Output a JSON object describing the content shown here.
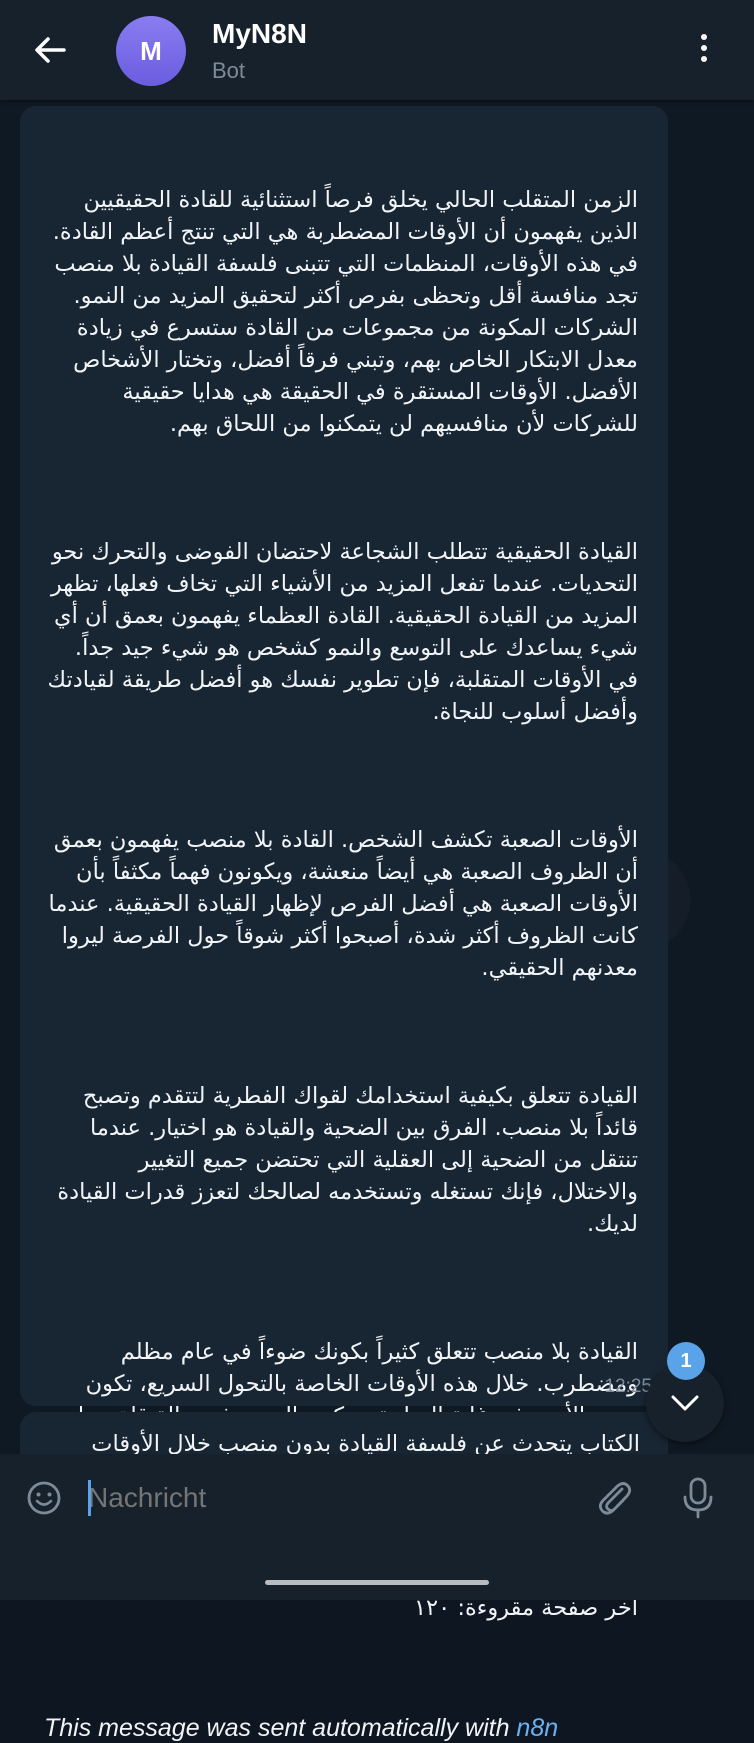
{
  "header": {
    "title": "MyN8N",
    "subtitle": "Bot",
    "avatar_letter": "M"
  },
  "message": {
    "paragraphs": [
      "الزمن المتقلب الحالي يخلق فرصاً استثنائية للقادة الحقيقيين الذين يفهمون أن الأوقات المضطربة هي التي تنتج أعظم القادة. في هذه الأوقات، المنظمات التي تتبنى فلسفة القيادة بلا منصب تجد منافسة أقل وتحظى بفرص أكثر لتحقيق المزيد من النمو. الشركات المكونة من مجموعات من القادة ستسرع في زيادة معدل الابتكار الخاص بهم، وتبني فرقاً أفضل، وتختار الأشخاص الأفضل. الأوقات المستقرة في الحقيقة هي هدايا حقيقية للشركات لأن منافسيهم لن يتمكنوا من اللحاق بهم.",
      "القيادة الحقيقية تتطلب الشجاعة لاحتضان الفوضى والتحرك نحو التحديات. عندما تفعل المزيد من الأشياء التي تخاف فعلها، تظهر المزيد من القيادة الحقيقية. القادة العظماء يفهمون بعمق أن أي شيء يساعدك على التوسع والنمو كشخص هو شيء جيد جداً. في الأوقات المتقلبة، فإن تطوير نفسك هو أفضل طريقة لقيادتك وأفضل أسلوب للنجاة.",
      "الأوقات الصعبة تكشف الشخص. القادة بلا منصب يفهمون بعمق أن الظروف الصعبة هي أيضاً منعشة، ويكونون فهماً مكثفاً بأن الأوقات الصعبة هي أفضل الفرص لإظهار القيادة الحقيقية. عندما كانت الظروف أكثر شدة، أصبحوا أكثر شوقاً حول الفرصة ليروا معدنهم الحقيقي.",
      "القيادة تتعلق بكيفية استخدامك لقواك الفطرية لتتقدم وتصبح قائداً بلا منصب. الفرق بين الضحية والقيادة هو اختيار. عندما تنتقل من الضحية إلى العقلية التي تحتضن جميع التغيير والاختلال، فإنك تستغله وتستخدمه لصالحك لتعزز قدرات القيادة لديك.",
      "القيادة بلا منصب تتعلق كثيراً بكونك ضوءاً في عام مظلم ومضطرب. خلال هذه الأوقات الخاصة بالتحول السريع، تكون جميع الأمور في غاية السلبية، ويكون الجميع في حالة قلق. ما نحتاجه الآن هو المزيد من الأشخاص الذين يكونون ضوء ثبات لامع، ممتلئين بالأمل، ويوضحون للآخرين طريقاً واضحاً."
    ],
    "last_page": "آخر صفحة مقروءة: ١٢٠",
    "footer_prefix": "This message was sent automatically with ",
    "footer_link": "n8n",
    "time": "12:25"
  },
  "next_message": {
    "text": "الكتاب يتحدث عن فلسفة القيادة بدون منصب خلال الأوقات"
  },
  "unread_count": "1",
  "composer": {
    "placeholder": "Nachricht"
  },
  "colors": {
    "header_bg": "#17212b",
    "chat_bg": "#0f1923",
    "bubble_bg": "#182533",
    "link": "#6ab2f2",
    "accent": "#5aa3e8"
  },
  "icons": [
    "back-arrow-icon",
    "more-vert-icon",
    "chevron-down-icon",
    "emoji-icon",
    "paperclip-icon",
    "microphone-icon"
  ]
}
